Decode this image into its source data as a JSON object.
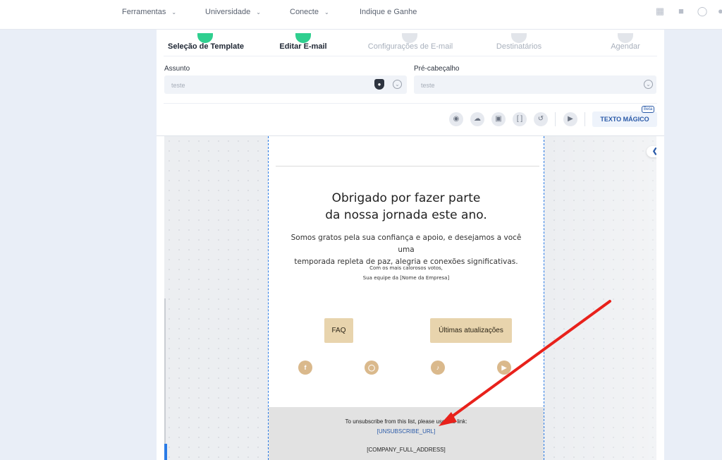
{
  "nav": {
    "items": [
      {
        "label": "Ferramentas",
        "dropdown": true
      },
      {
        "label": "Universidade",
        "dropdown": true
      },
      {
        "label": "Conecte",
        "dropdown": true
      },
      {
        "label": "Indique e Ganhe",
        "dropdown": false
      }
    ],
    "icons": [
      "book-icon",
      "video-icon",
      "headset-icon",
      "user-icon"
    ]
  },
  "steps": [
    {
      "label": "Seleção de Template",
      "state": "done"
    },
    {
      "label": "Editar E-mail",
      "state": "current"
    },
    {
      "label": "Configurações de E-mail",
      "state": "pending"
    },
    {
      "label": "Destinatários",
      "state": "pending"
    },
    {
      "label": "Agendar",
      "state": "pending"
    }
  ],
  "fields": {
    "subject": {
      "label": "Assunto",
      "value": "teste"
    },
    "preheader": {
      "label": "Pré-cabeçalho",
      "value": "teste"
    }
  },
  "toolbar": {
    "magic_label": "TEXTO MÁGICO",
    "beta_label": "Beta"
  },
  "email": {
    "title_line1": "Obrigado por fazer parte",
    "title_line2": "da nossa jornada este ano.",
    "body_line1": "Somos gratos pela sua confiança e apoio, e desejamos a você uma",
    "body_line2": "temporada repleta de paz, alegria e conexões significativas.",
    "sign_line1": "Com os mais calorosos votos,",
    "sign_line2": "Sua equipe da [Nome da Empresa]",
    "button_faq": "FAQ",
    "button_updates": "Últimas atualizações",
    "social": [
      "facebook",
      "instagram",
      "tiktok",
      "youtube"
    ],
    "footer_text": "To unsubscribe from this list, please use this link:",
    "unsubscribe": "[UNSUBSCRIBE_URL]",
    "address": "[COMPANY_FULL_ADDRESS]"
  },
  "colors": {
    "accent_blue": "#2a7be6",
    "step_green": "#2fcf8f",
    "button_tan": "#e8d4ad",
    "social_tan": "#dab98c",
    "arrow_red": "#e8211b"
  }
}
